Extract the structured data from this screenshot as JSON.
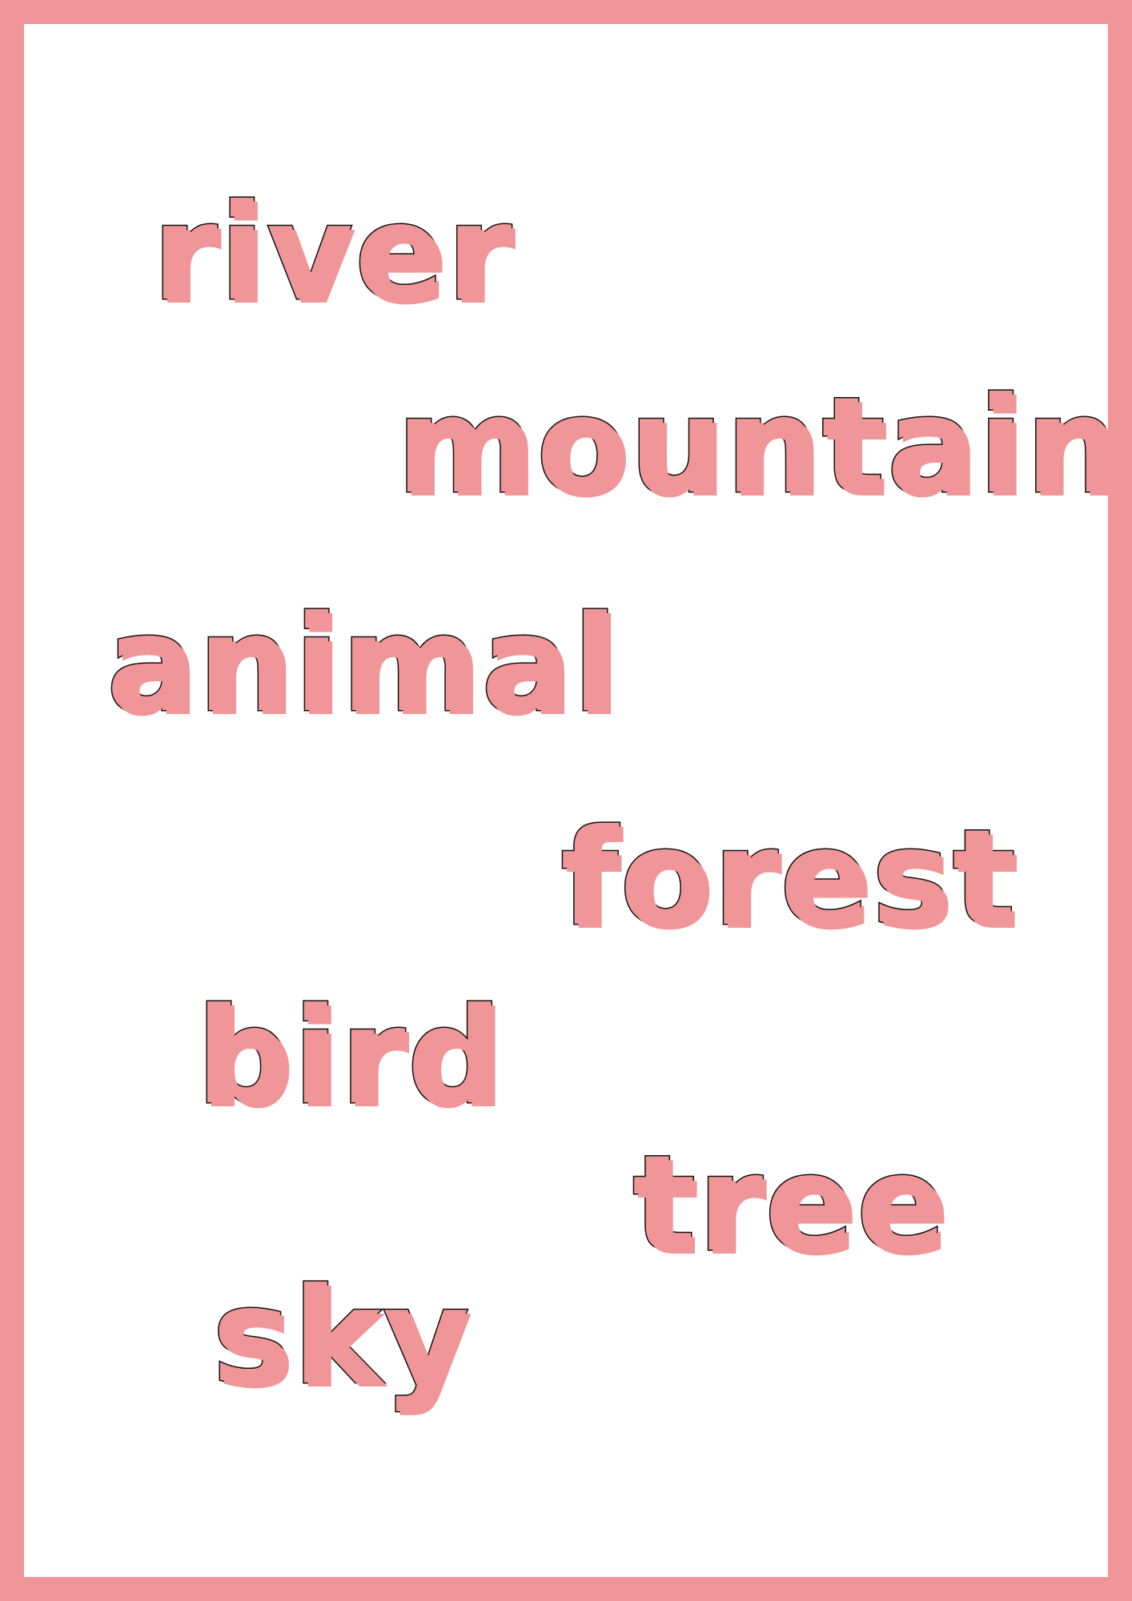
{
  "colors": {
    "border": "#f09698",
    "word_fill": "#f09698",
    "word_outline": "#111111",
    "background": "#ffffff"
  },
  "words": [
    "river",
    "mountain",
    "animal",
    "forest",
    "bird",
    "tree",
    "sky"
  ]
}
